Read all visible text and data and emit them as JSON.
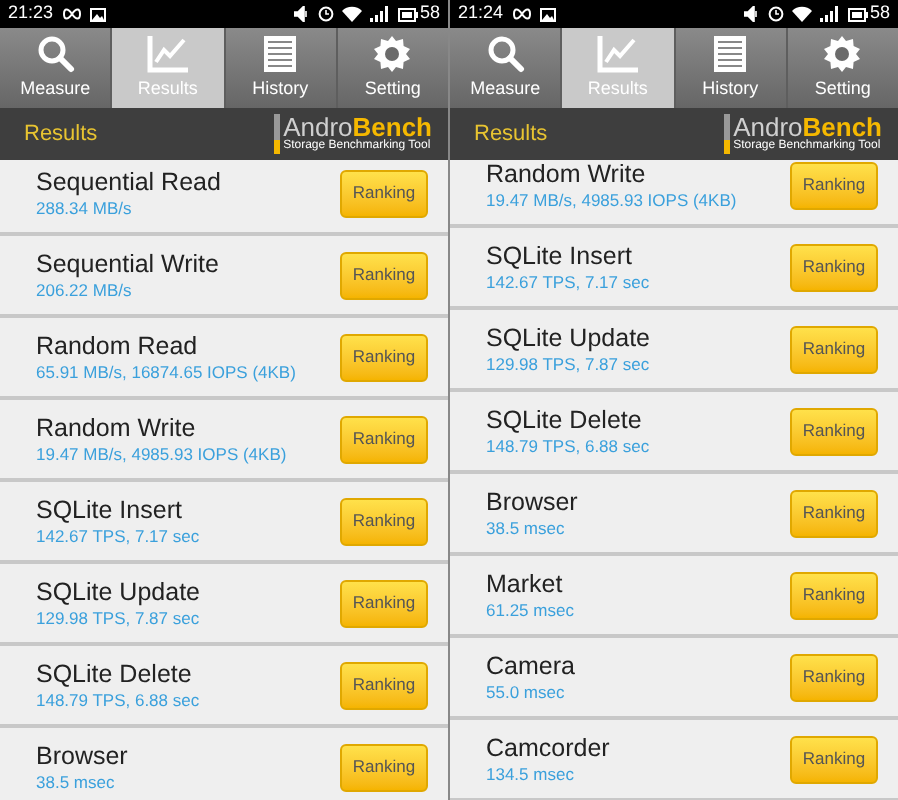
{
  "panels": [
    {
      "status_bar": {
        "time": "21:23",
        "battery": "58"
      },
      "tabs": [
        {
          "label": "Measure",
          "kind": "search",
          "selected": false
        },
        {
          "label": "Results",
          "kind": "chart",
          "selected": true
        },
        {
          "label": "History",
          "kind": "list",
          "selected": false
        },
        {
          "label": "Setting",
          "kind": "gear",
          "selected": false
        }
      ],
      "header": {
        "title": "Results",
        "logo_a": "Andro",
        "logo_b": "Bench",
        "tagline": "Storage Benchmarking Tool"
      },
      "scrolled": false,
      "results": [
        {
          "name": "Sequential Read",
          "value": "288.34 MB/s",
          "button": "Ranking"
        },
        {
          "name": "Sequential Write",
          "value": "206.22 MB/s",
          "button": "Ranking"
        },
        {
          "name": "Random Read",
          "value": "65.91 MB/s, 16874.65 IOPS (4KB)",
          "button": "Ranking"
        },
        {
          "name": "Random Write",
          "value": "19.47 MB/s, 4985.93 IOPS (4KB)",
          "button": "Ranking"
        },
        {
          "name": "SQLite Insert",
          "value": "142.67 TPS, 7.17 sec",
          "button": "Ranking"
        },
        {
          "name": "SQLite Update",
          "value": "129.98 TPS, 7.87 sec",
          "button": "Ranking"
        },
        {
          "name": "SQLite Delete",
          "value": "148.79 TPS, 6.88 sec",
          "button": "Ranking"
        },
        {
          "name": "Browser",
          "value": "38.5 msec",
          "button": "Ranking"
        }
      ]
    },
    {
      "status_bar": {
        "time": "21:24",
        "battery": "58"
      },
      "tabs": [
        {
          "label": "Measure",
          "kind": "search",
          "selected": false
        },
        {
          "label": "Results",
          "kind": "chart",
          "selected": true
        },
        {
          "label": "History",
          "kind": "list",
          "selected": false
        },
        {
          "label": "Setting",
          "kind": "gear",
          "selected": false
        }
      ],
      "header": {
        "title": "Results",
        "logo_a": "Andro",
        "logo_b": "Bench",
        "tagline": "Storage Benchmarking Tool"
      },
      "scrolled": true,
      "results": [
        {
          "name": "Random Write",
          "value": "19.47 MB/s, 4985.93 IOPS (4KB)",
          "button": "Ranking"
        },
        {
          "name": "SQLite Insert",
          "value": "142.67 TPS, 7.17 sec",
          "button": "Ranking"
        },
        {
          "name": "SQLite Update",
          "value": "129.98 TPS, 7.87 sec",
          "button": "Ranking"
        },
        {
          "name": "SQLite Delete",
          "value": "148.79 TPS, 6.88 sec",
          "button": "Ranking"
        },
        {
          "name": "Browser",
          "value": "38.5 msec",
          "button": "Ranking"
        },
        {
          "name": "Market",
          "value": "61.25 msec",
          "button": "Ranking"
        },
        {
          "name": "Camera",
          "value": "55.0 msec",
          "button": "Ranking"
        },
        {
          "name": "Camcorder",
          "value": "134.5 msec",
          "button": "Ranking"
        }
      ]
    }
  ]
}
